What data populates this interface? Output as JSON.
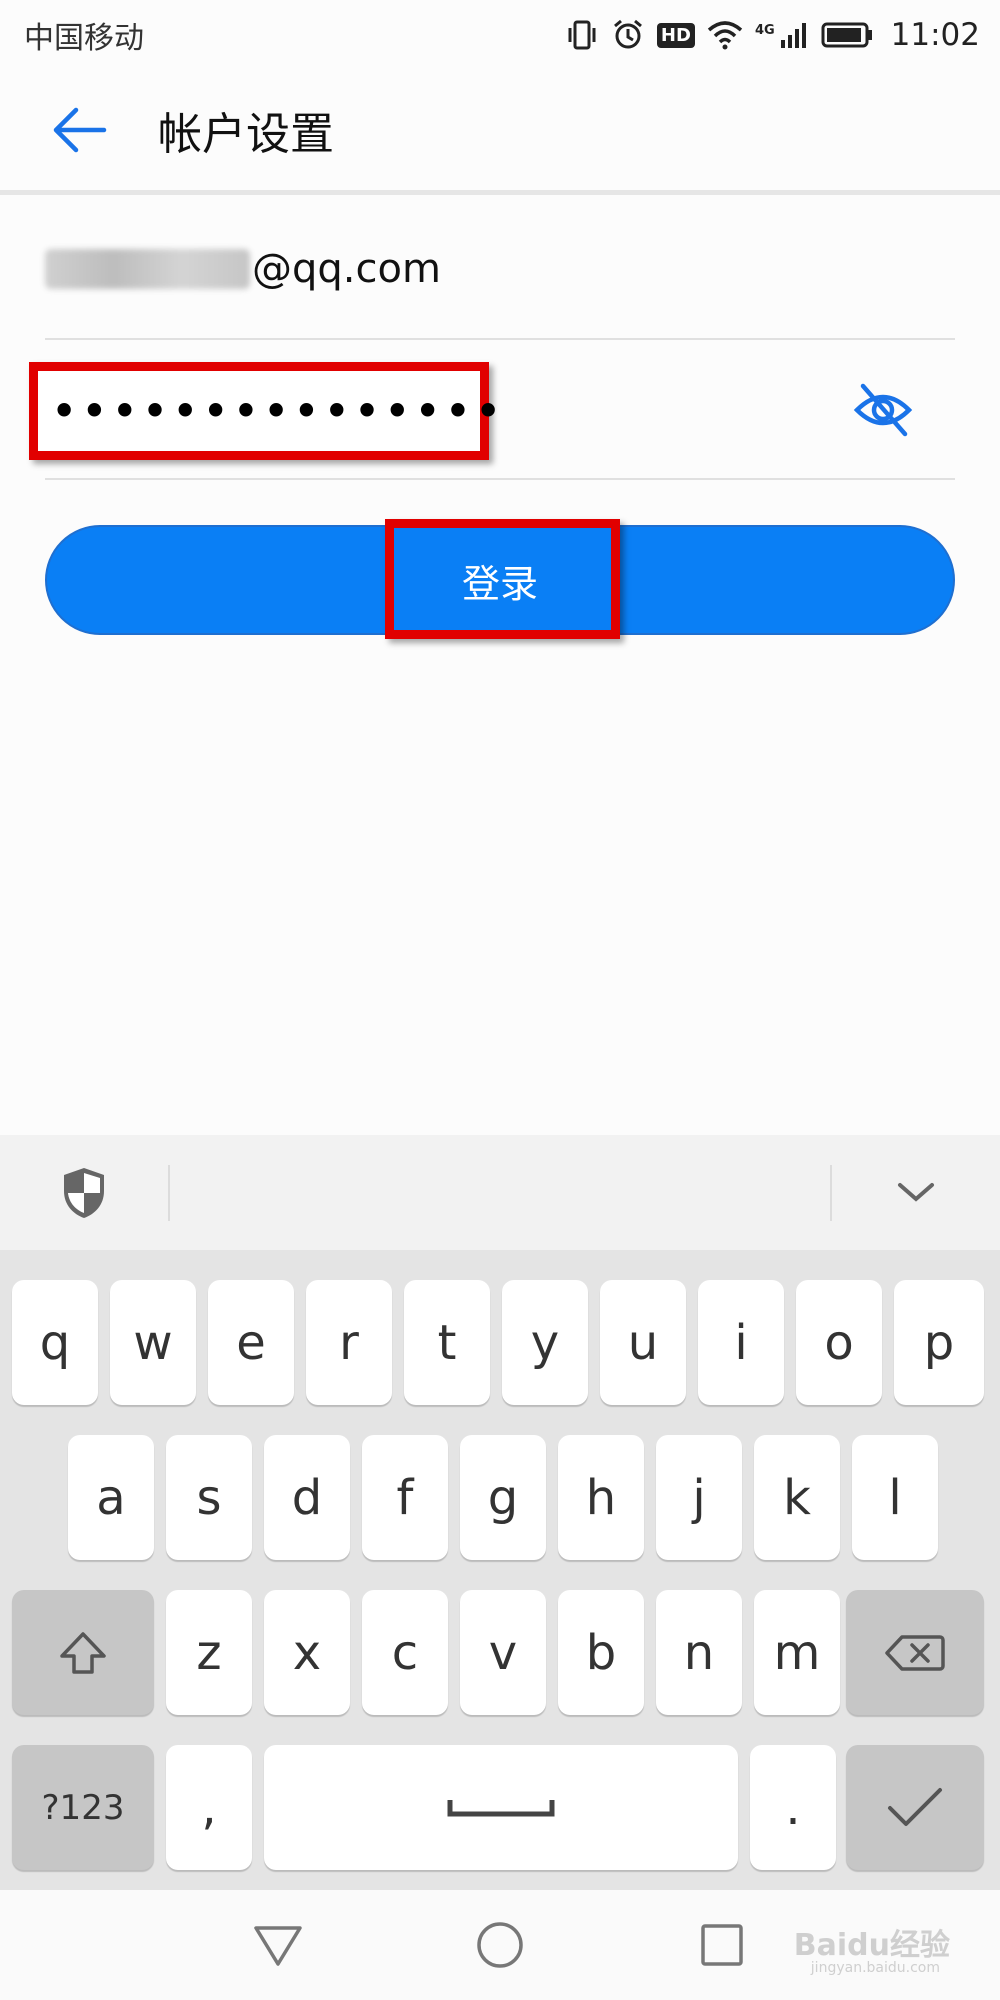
{
  "status_bar": {
    "carrier": "中国移动",
    "hd_badge": "HD",
    "network": "4G",
    "time": "11:02",
    "icons": [
      "vibrate-icon",
      "alarm-icon",
      "hd-icon",
      "wifi-icon",
      "signal-icon",
      "battery-icon"
    ]
  },
  "app_bar": {
    "title": "帐户设置",
    "back_icon": "arrow-left-icon"
  },
  "form": {
    "email_domain": "@qq.com",
    "password_mask": "•••••••••••••••",
    "toggle_icon": "eye-off-icon"
  },
  "login": {
    "label": "登录"
  },
  "keyboard": {
    "row1": [
      "q",
      "w",
      "e",
      "r",
      "t",
      "y",
      "u",
      "i",
      "o",
      "p"
    ],
    "row2": [
      "a",
      "s",
      "d",
      "f",
      "g",
      "h",
      "j",
      "k",
      "l"
    ],
    "row3": [
      "z",
      "x",
      "c",
      "v",
      "b",
      "n",
      "m"
    ],
    "symbols_label": "?123",
    "comma_label": ",",
    "period_label": "."
  },
  "watermark": {
    "text": "Baidu经验",
    "sub": "jingyan.baidu.com"
  },
  "colors": {
    "accent": "#0a7ff5",
    "highlight": "#e10000"
  }
}
